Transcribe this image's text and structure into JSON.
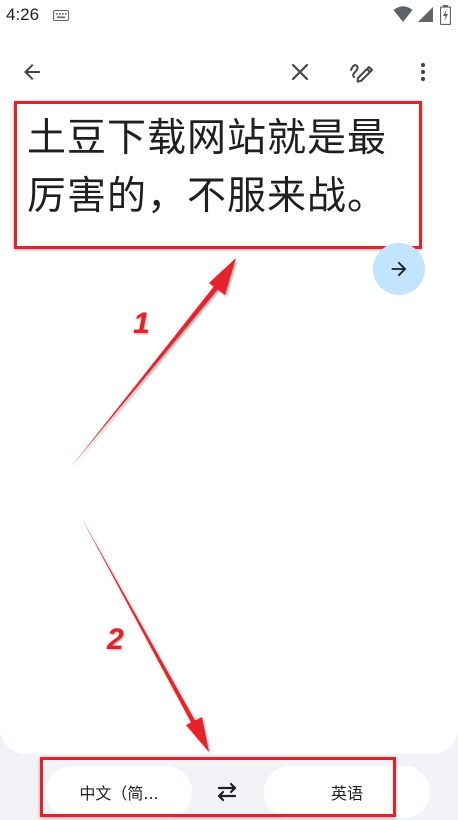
{
  "status_bar": {
    "time": "4:26",
    "icons": [
      "keyboard-icon",
      "wifi-icon",
      "signal-icon",
      "battery-charging-icon"
    ]
  },
  "toolbar": {
    "back_icon": "arrow-back-icon",
    "clear_icon": "close-icon",
    "handwrite_icon": "handwriting-icon",
    "more_icon": "more-vert-icon"
  },
  "input": {
    "text": "土豆下载网站就是最厉害的，不服来战。"
  },
  "translate_button": {
    "icon": "arrow-forward-icon"
  },
  "annotations": {
    "label_1": "1",
    "label_2": "2"
  },
  "languages": {
    "source": "中文（简...",
    "target": "英语",
    "swap_icon": "swap-horiz-icon"
  },
  "colors": {
    "annotation_red": "#e8202a",
    "translate_button_bg": "#c2e4ff",
    "app_background": "#f2f3f7"
  }
}
